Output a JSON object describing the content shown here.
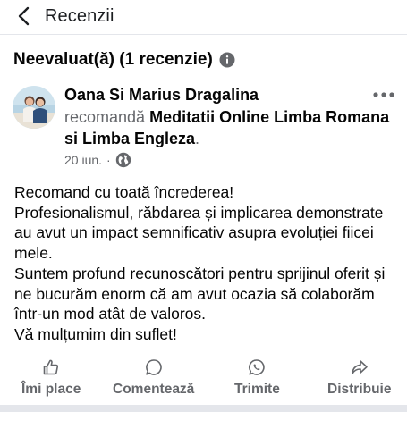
{
  "header": {
    "back_icon": "chevron-left-icon",
    "title": "Recenzii"
  },
  "section": {
    "heading": "Neevaluat(ă) (1 recenzie)",
    "info_icon": "info-icon"
  },
  "review": {
    "author": "Oana Si Marius Dragalina",
    "verb": "recomandă",
    "page": "Meditatii Online Limba Romana si Limba Engleza",
    "trailing": ".",
    "date": "20 iun.",
    "separator": "·",
    "privacy_icon": "globe-icon",
    "more_icon": "more-options-icon",
    "body_lines": [
      "Recomand cu toată încrederea!",
      "Profesionalismul, răbdarea și implicarea demonstrate au avut un impact semnificativ asupra evoluției fiicei mele.",
      "Suntem profund recunoscători pentru sprijinul oferit și ne bucurăm enorm că am avut ocazia să colaborăm într-un mod atât de valoros.",
      "Vă mulțumim din suflet!"
    ]
  },
  "actions": {
    "like": {
      "label": "Îmi place",
      "icon": "thumbs-up-icon"
    },
    "comment": {
      "label": "Comentează",
      "icon": "comment-icon"
    },
    "send": {
      "label": "Trimite",
      "icon": "whatsapp-icon"
    },
    "share": {
      "label": "Distribuie",
      "icon": "share-icon"
    }
  },
  "colors": {
    "text_primary": "#050505",
    "text_secondary": "#65676b",
    "divider": "#e4e6eb"
  }
}
